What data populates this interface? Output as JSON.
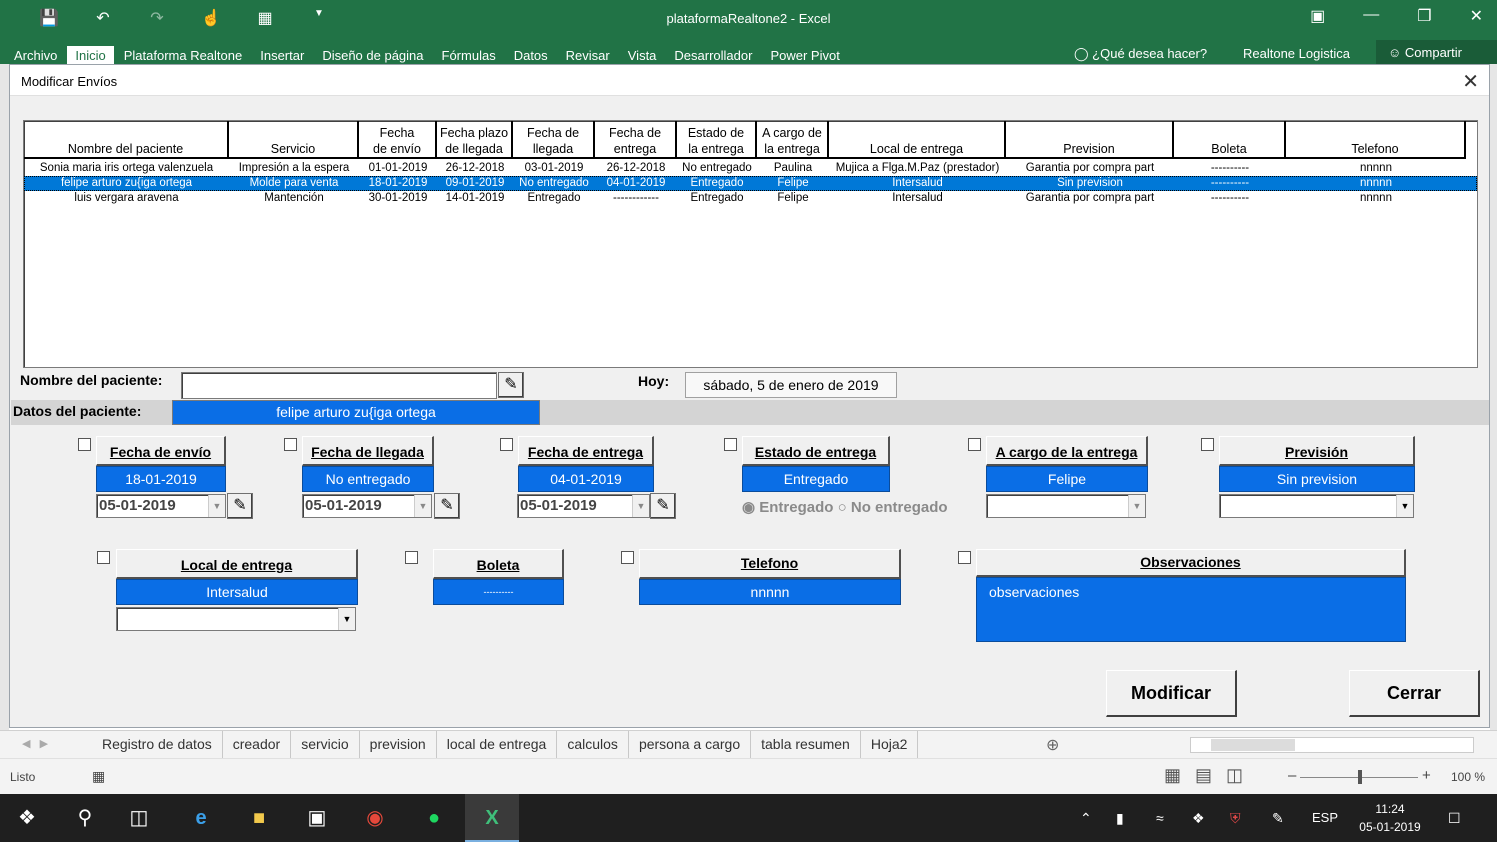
{
  "excel": {
    "title": "plataformaRealtone2 - Excel",
    "tabs": [
      "Archivo",
      "Inicio",
      "Plataforma Realtone",
      "Insertar",
      "Diseño de página",
      "Fórmulas",
      "Datos",
      "Revisar",
      "Vista",
      "Desarrollador",
      "Power Pivot"
    ],
    "active_tab": "Inicio",
    "tell_me": "¿Qué desea hacer?",
    "brand": "Realtone Logistica",
    "share": "Compartir"
  },
  "form": {
    "title": "Modificar Envíos",
    "close": "✕",
    "columns": [
      "Nombre del paciente",
      "Servicio",
      "Fecha\nde envío",
      "Fecha plazo\nde llegada",
      "Fecha de\nllegada",
      "Fecha de\nentrega",
      "Estado de\nla entrega",
      "A cargo de\nla entrega",
      "Local de entrega",
      "Prevision",
      "Boleta",
      "Telefono"
    ],
    "rows": [
      [
        "Sonia maria iris ortega valenzuela",
        "Impresión a la espera",
        "01-01-2019",
        "26-12-2018",
        "03-01-2019",
        "26-12-2018",
        "No entregado",
        "Paulina",
        "Mujica a Flga.M.Paz (prestador)",
        "Garantia por compra part",
        "----------",
        "nnnnn"
      ],
      [
        "felipe arturo zu{iga ortega",
        "Molde para venta",
        "18-01-2019",
        "09-01-2019",
        "No entregado",
        "04-01-2019",
        "Entregado",
        "Felipe",
        "Intersalud",
        "Sin prevision",
        "----------",
        "nnnnn"
      ],
      [
        "luis vergara aravena",
        "Mantención",
        "30-01-2019",
        "14-01-2019",
        "Entregado",
        "------------",
        "Entregado",
        "Felipe",
        "Intersalud",
        "Garantia por compra part",
        "----------",
        "nnnnn"
      ]
    ],
    "selected_row": 1,
    "patient_label": "Nombre del paciente:",
    "patient_value": "",
    "today_label": "Hoy:",
    "today_value": "sábado, 5 de enero de 2019",
    "data_label": "Datos del paciente:",
    "data_value": "felipe arturo zu{iga ortega",
    "fields": {
      "envio": {
        "label": "Fecha de envío",
        "value": "18-01-2019",
        "input": "05-01-2019"
      },
      "llegada": {
        "label": "Fecha de llegada",
        "value": "No entregado",
        "input": "05-01-2019"
      },
      "entrega": {
        "label": "Fecha de entrega",
        "value": "04-01-2019",
        "input": "05-01-2019"
      },
      "estado": {
        "label": "Estado de entrega",
        "value": "Entregado",
        "radio_1": "Entregado",
        "radio_2": "No entregado"
      },
      "cargo": {
        "label": "A cargo de la entrega",
        "value": "Felipe",
        "input": ""
      },
      "prevision": {
        "label": "Previsión",
        "value": "Sin prevision",
        "input": ""
      },
      "local": {
        "label": "Local de entrega",
        "value": "Intersalud",
        "input": ""
      },
      "boleta": {
        "label": "Boleta",
        "value": "----------"
      },
      "telefono": {
        "label": "Telefono",
        "value": "nnnnn"
      },
      "observaciones": {
        "label": "Observaciones",
        "value": "observaciones"
      }
    },
    "buttons": {
      "modify": "Modificar",
      "close": "Cerrar"
    }
  },
  "sheets": {
    "tabs": [
      "Registro de datos",
      "creador",
      "servicio",
      "prevision",
      "local de entrega",
      "calculos",
      "persona a cargo",
      "tabla resumen",
      "Hoja2"
    ],
    "active": 0
  },
  "status": {
    "ready": "Listo",
    "zoom": "100 %"
  },
  "taskbar": {
    "lang": "ESP",
    "time": "11:24",
    "date": "05-01-2019"
  },
  "icons": [
    "save-icon",
    "undo-icon",
    "redo-icon",
    "touch-mode-icon",
    "form-icon",
    "customize-icon",
    "picker-icon",
    "windows-start-icon",
    "search-icon",
    "task-view-icon",
    "edge-icon",
    "file-explorer-icon",
    "store-icon",
    "chrome-icon",
    "spotify-icon",
    "excel-icon"
  ]
}
